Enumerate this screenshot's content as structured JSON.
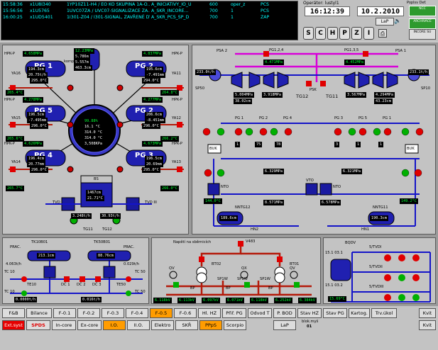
{
  "alarms": [
    {
      "time": "15:58:36",
      "id": "x1U8I340",
      "text": "1YP10Z11-H4 / EO KO SKUPINA 1A-O...",
      "group": "A_INICIATIVY_IO_U",
      "num": "600",
      "user": "oper_z",
      "sys": "PCS"
    },
    {
      "time": "15:56:56",
      "id": "x1U5765",
      "text": "1UVC07ZA / UVC07-SIGNALIZACE ZA...",
      "group": "A_SKR_INCORE...",
      "num": "700",
      "user": "1",
      "sys": "PCS"
    },
    {
      "time": "16:00:25",
      "id": "x1UD5401",
      "text": "1I301-Z04 / I301-SIGNAL, ZAVŘENÉ DV...",
      "group": "A_SKR_PCS_SP_D",
      "num": "700",
      "user": "1",
      "sys": "ZAP"
    }
  ],
  "header": {
    "operator": "Operátor: lustyl1",
    "time": "16:12:39",
    "date": "10.2.2010",
    "lap": "LaP",
    "buttons": [
      "S",
      "C",
      "H",
      "P",
      "Z",
      "I"
    ],
    "poplsel": "Poplsv  Def.",
    "right_top": "NCC",
    "right_mid": "ARCHIVACE",
    "right_bot": "INCORE SU"
  },
  "reactor": {
    "pg": [
      "PG 1",
      "PG 2",
      "PG 3",
      "PG 4",
      "PG 5",
      "PG 6"
    ],
    "hpk": [
      "HPK-P",
      "HPK-P",
      "HPK-P",
      "HPK-P",
      "HPK-P",
      "HPK-P"
    ],
    "ya": [
      "YA16",
      "YA11",
      "YA12",
      "YA13",
      "YA14",
      "YA15"
    ],
    "p_top": [
      "4.658MPa",
      "4.837MPa",
      "4.278MPa",
      "4.277MPa",
      "4.626MPa",
      "4.673MPa"
    ],
    "temp_in": [
      "295.0°C",
      "294.0°C",
      "296.0°C",
      "296.0°C",
      "296.0°C",
      "295.0°C"
    ],
    "temp_hot": [
      "265.4°C",
      "264.8°C",
      "265.6°C",
      "266.2°C",
      "265.7°C",
      "266.0°C"
    ],
    "level1": [
      "194.3cm",
      "195.6cm",
      "196.5cm",
      "206.6cm",
      "196.4cm",
      "196.5cm"
    ],
    "level2": [
      "20.75t/h",
      "-7.491mm",
      "-7.495mm",
      "-8.451mm",
      "20.77mm",
      "20.69mm"
    ],
    "core": [
      "99.88%",
      "16.1 °C",
      "314.0 °C",
      "314.0 °C",
      "3,508KPa"
    ],
    "kompen": "kompen",
    "kompen_vals": [
      "12.23MPa",
      "5.786m",
      "5.557m",
      "463.3cm"
    ],
    "bs": "BS",
    "bs_vals": [
      "1467cm",
      "21.71°C"
    ],
    "tvd": [
      "TVD I",
      "TVD III"
    ],
    "tvd_vals": [
      "3.248t/h",
      "30.93t/h"
    ],
    "tg": [
      "TG11",
      "TG12"
    ]
  },
  "turbine": {
    "psa": [
      "PSA 2",
      "PSA 1"
    ],
    "pg_bus": [
      "PG1,2,4",
      "PG1,3,5"
    ],
    "pg_vals": [
      "4.471MPa",
      "4.452MPa"
    ],
    "side_vals": [
      "233.0t/h",
      "233.1t/h"
    ],
    "sp": [
      "SP50",
      "SP10"
    ],
    "tg": [
      "TG12",
      "TG11"
    ],
    "mpa": [
      "5.004MPa",
      "3.918MPa",
      "3.567MPa",
      "4.294MPa"
    ],
    "cm": [
      "38.02cm",
      "43.23cm"
    ],
    "psk": "PSK",
    "pg_sub": [
      "PG 1",
      "PG 2",
      "PG 4",
      "PG 3",
      "PG 5",
      "PG 1"
    ],
    "npk": [
      "1",
      "75",
      "78",
      "3",
      "1",
      "1"
    ],
    "bus": [
      "BUK",
      "BUK"
    ],
    "nto": [
      "NTO",
      "NTO"
    ],
    "nto_vals": [
      "144.0°C",
      "149.2°C"
    ],
    "ntg": [
      "NNTG12",
      "NNTG11"
    ],
    "ntg_vals": [
      "189.6cm",
      "190.3cm"
    ],
    "vals": [
      "6.329MPa",
      "6.321MPa",
      "8.571MPa",
      "6.578MPa"
    ],
    "vto": "VTO",
    "hn": [
      "HN2",
      "HN1"
    ]
  },
  "tk": {
    "labels": [
      "TK10B01",
      "TK50B01"
    ],
    "prac": [
      "PRAC.",
      "PRAC."
    ],
    "temps": [
      "213.1cm",
      "88.76cm"
    ],
    "flows": [
      "4.063t/h",
      "0.029t/h"
    ],
    "tc": [
      "TC 10",
      "TC 50",
      "TC 10",
      "TC 50"
    ],
    "te": [
      "TE10",
      "TE50"
    ],
    "dc": [
      "DČ 1",
      "DČ 2",
      "DČ 3"
    ],
    "bottom": [
      "0.0000t/h",
      "0.016t/h"
    ]
  },
  "electric": {
    "title": "Napětí na sběrnicích",
    "top": "V483",
    "bt": [
      "BT02",
      "BT01"
    ],
    "qv": [
      "QV",
      "QX",
      "QV"
    ],
    "bp": [
      "BP",
      "BP",
      "BP"
    ],
    "nodes": [
      "SP1W",
      "SP1W",
      "SP1W"
    ],
    "bottom": [
      "6.118kV",
      "6.113kV",
      "6.097kV",
      "6.071kV",
      "6.118kV",
      "6.252kV",
      "6.384kV"
    ]
  },
  "bqdv": {
    "label": "BQDV",
    "rows": [
      "5/TVDI",
      "5/TVDII",
      "5/TVDIII"
    ],
    "rows2": [
      "15.1 03.1",
      "15.1 03.2"
    ],
    "val": "15.69°C"
  },
  "nav": {
    "row1": [
      "F&B",
      "Bilance",
      "F-0.1",
      "F-0.2",
      "F-0.3",
      "F-0.4",
      "F-0.5",
      "F-0.6",
      "Hl. HZ",
      "Přiř. PG",
      "Odvod T",
      "P. BOD",
      "Stav HZ",
      "Stav PG",
      "Kartog.",
      "Trv.úkol",
      "Kvit"
    ],
    "row2": [
      "Ext.syst",
      "SPDS",
      "In-core",
      "Ex-core",
      "I.O.",
      "II.O.",
      "Elektro",
      "SKŘ",
      "PPpS",
      "Scorpio",
      "LaP",
      "Kvit"
    ],
    "blok": "blok.myš",
    "blok_val": "01"
  },
  "colors": {
    "pipe_blue": "#1414c8",
    "pipe_magenta": "#d800d8",
    "pipe_red": "#b41a0a",
    "valve_red": "#e00000",
    "valve_green": "#00b000",
    "panel": "#c3c3c3"
  }
}
